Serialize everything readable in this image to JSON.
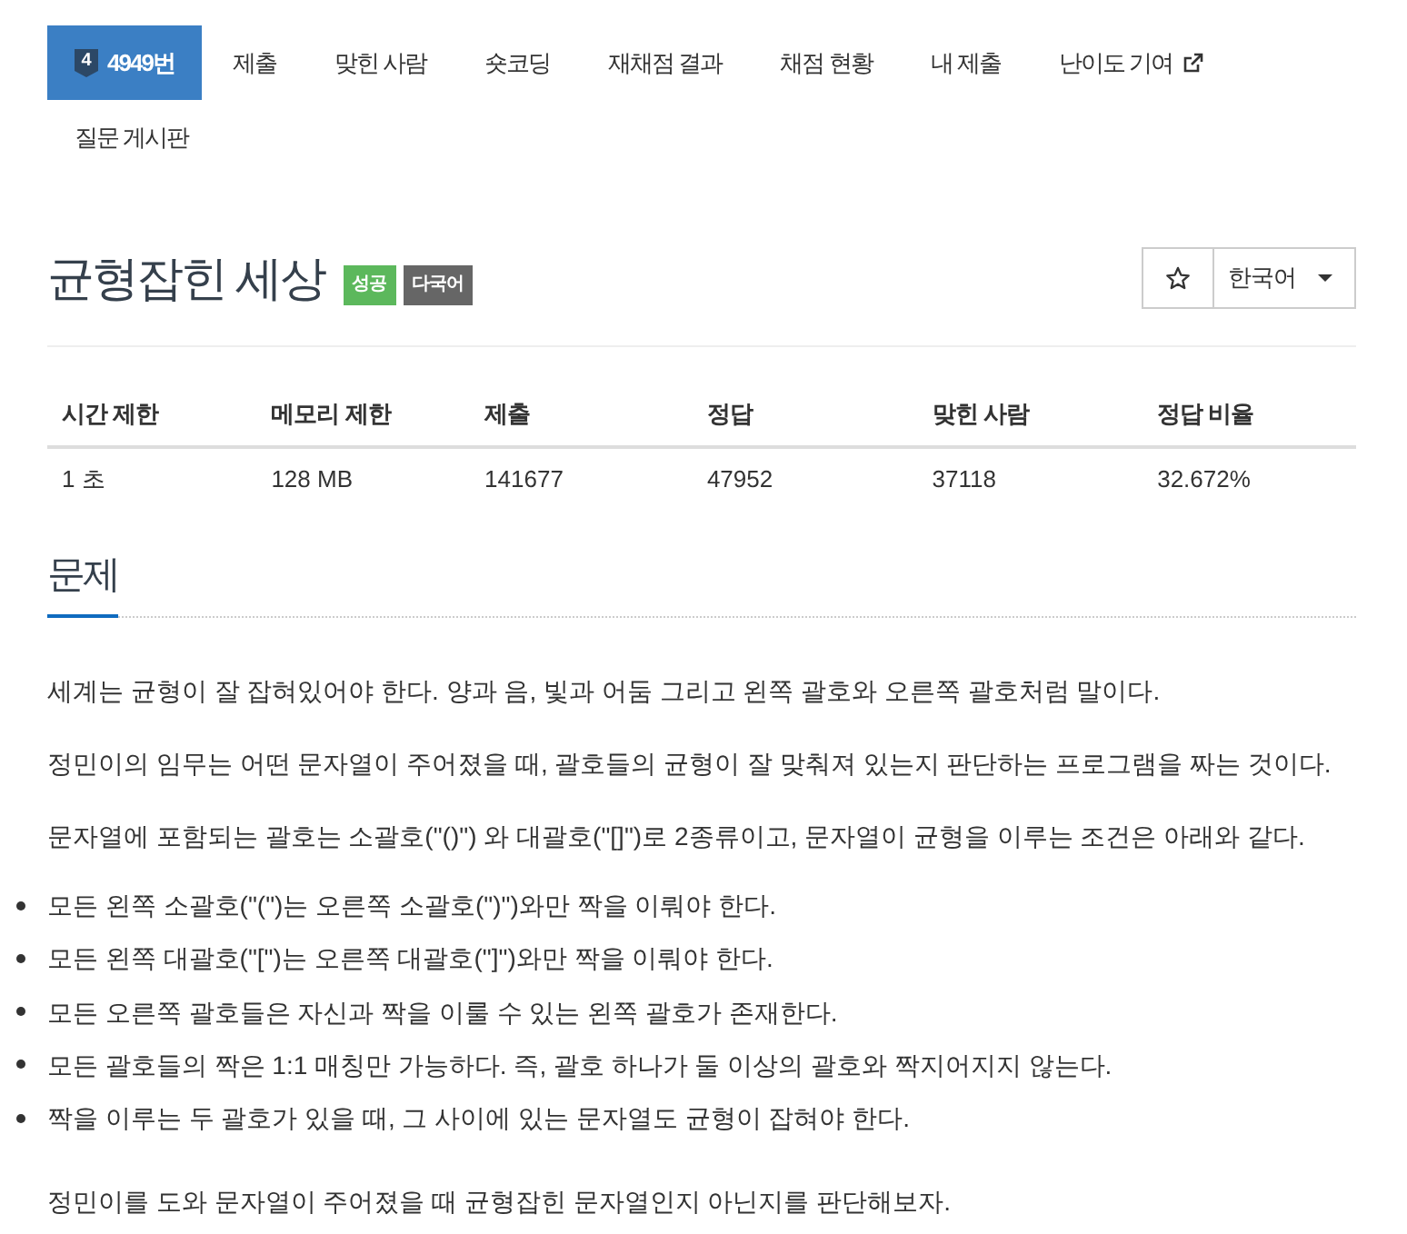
{
  "nav": {
    "tabs": [
      {
        "label": "4949번",
        "selected": true,
        "tier": "4",
        "external": false
      },
      {
        "label": "제출",
        "selected": false,
        "external": false
      },
      {
        "label": "맞힌 사람",
        "selected": false,
        "external": false
      },
      {
        "label": "숏코딩",
        "selected": false,
        "external": false
      },
      {
        "label": "재채점 결과",
        "selected": false,
        "external": false
      },
      {
        "label": "채점 현황",
        "selected": false,
        "external": false
      },
      {
        "label": "내 제출",
        "selected": false,
        "external": false
      },
      {
        "label": "난이도 기여",
        "selected": false,
        "external": true
      },
      {
        "label": "질문 게시판",
        "selected": false,
        "external": false
      }
    ]
  },
  "problem": {
    "title": "균형잡힌 세상",
    "badges": [
      {
        "label": "성공",
        "color": "#5cb85c"
      },
      {
        "label": "다국어",
        "color": "#666666"
      }
    ],
    "favorite": {
      "starred": false
    },
    "language_select": {
      "value": "한국어"
    }
  },
  "stats": {
    "columns": [
      "시간 제한",
      "메모리 제한",
      "제출",
      "정답",
      "맞힌 사람",
      "정답 비율"
    ],
    "rows": [
      [
        "1 초",
        "128 MB",
        "141677",
        "47952",
        "37118",
        "32.672%"
      ]
    ]
  },
  "section": {
    "heading": "문제",
    "paragraphs": [
      "세계는 균형이 잘 잡혀있어야 한다. 양과 음, 빛과 어둠 그리고 왼쪽 괄호와 오른쪽 괄호처럼 말이다.",
      "정민이의 임무는 어떤 문자열이 주어졌을 때, 괄호들의 균형이 잘 맞춰져 있는지 판단하는 프로그램을 짜는 것이다.",
      "문자열에 포함되는 괄호는 소괄호(\"()\") 와 대괄호(\"[]\")로 2종류이고, 문자열이 균형을 이루는 조건은 아래와 같다."
    ],
    "rules": [
      "모든 왼쪽 소괄호(\"(\")는 오른쪽 소괄호(\")\")와만 짝을 이뤄야 한다.",
      "모든 왼쪽 대괄호(\"[\")는 오른쪽 대괄호(\"]\")와만 짝을 이뤄야 한다.",
      "모든 오른쪽 괄호들은 자신과 짝을 이룰 수 있는 왼쪽 괄호가 존재한다.",
      "모든 괄호들의 짝은 1:1 매칭만 가능하다. 즉, 괄호 하나가 둘 이상의 괄호와 짝지어지지 않는다.",
      "짝을 이루는 두 괄호가 있을 때, 그 사이에 있는 문자열도 균형이 잡혀야 한다."
    ],
    "closing": "정민이를 도와 문자열이 주어졌을 때 균형잡힌 문자열인지 아닌지를 판단해보자."
  }
}
